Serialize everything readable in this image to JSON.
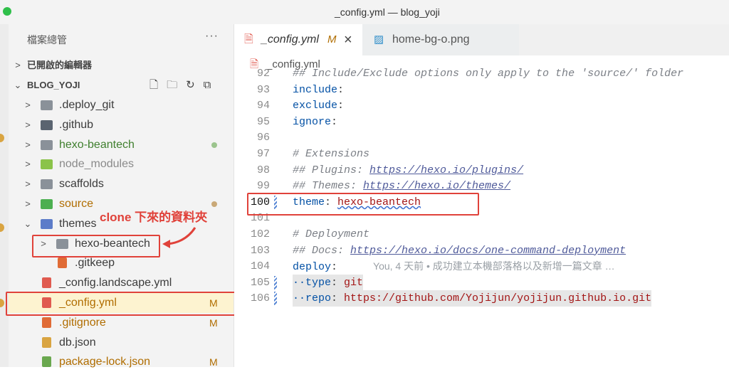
{
  "window": {
    "title": "_config.yml — blog_yoji"
  },
  "sidebar": {
    "header": "檔案總管",
    "more": "···",
    "open_editors": "已開啟的編輯器",
    "project": "BLOG_YOJI",
    "items": [
      {
        "label": ".deploy_git",
        "chevron": ">",
        "icon": "folder-icon",
        "color": "#8a9199"
      },
      {
        "label": ".github",
        "chevron": ">",
        "icon": "github-folder-icon",
        "color": "#5a6470"
      },
      {
        "label": "hexo-beantech",
        "chevron": ">",
        "icon": "folder-icon",
        "color": "#8a9199",
        "text_color": "#3f7f2e",
        "status_dot": "#9bc48d"
      },
      {
        "label": "node_modules",
        "chevron": ">",
        "icon": "node-folder-icon",
        "color": "#8bc34a",
        "text_color": "#8a8a8a"
      },
      {
        "label": "scaffolds",
        "chevron": ">",
        "icon": "folder-icon",
        "color": "#8a9199"
      },
      {
        "label": "source",
        "chevron": ">",
        "icon": "source-folder-icon",
        "color": "#4caf50",
        "text_color": "#b06d00",
        "status_dot": "#c9a877"
      },
      {
        "label": "themes",
        "chevron": "v",
        "icon": "theme-folder-icon",
        "color": "#5c7cc9"
      },
      {
        "label": "hexo-beantech",
        "chevron": ">",
        "icon": "folder-icon",
        "color": "#8a9199"
      },
      {
        "label": ".gitkeep",
        "icon": "git-icon",
        "color": "#e06b35"
      },
      {
        "label": "_config.landscape.yml",
        "icon": "yaml-icon",
        "color": "#e05a4f"
      },
      {
        "label": "_config.yml",
        "icon": "yaml-icon",
        "color": "#e05a4f",
        "text_color": "#b06d00",
        "badge": "M"
      },
      {
        "label": ".gitignore",
        "icon": "git-icon",
        "color": "#e06b35",
        "text_color": "#b06d00",
        "badge": "M"
      },
      {
        "label": "db.json",
        "icon": "json-icon",
        "color": "#d9a441"
      },
      {
        "label": "package-lock.json",
        "icon": "node-icon",
        "color": "#6aa84f",
        "text_color": "#b06d00",
        "badge": "M"
      }
    ]
  },
  "annotation": {
    "text": "clone 下來的資料夾"
  },
  "tabs": [
    {
      "label": "_config.yml",
      "modified": "M",
      "close": "×",
      "icon": "yaml-icon"
    },
    {
      "label": "home-bg-o.png",
      "icon": "image-icon"
    }
  ],
  "breadcrumb": {
    "file": "_config.yml"
  },
  "editor": {
    "lines": [
      {
        "n": "92",
        "parts": [
          {
            "t": "## Include/Exclude options only apply to the 'source/' folder",
            "c": "cmt"
          }
        ]
      },
      {
        "n": "93",
        "parts": [
          {
            "t": "include",
            "c": "key"
          },
          {
            "t": ":",
            "c": ""
          }
        ]
      },
      {
        "n": "94",
        "parts": [
          {
            "t": "exclude",
            "c": "key"
          },
          {
            "t": ":",
            "c": ""
          }
        ]
      },
      {
        "n": "95",
        "parts": [
          {
            "t": "ignore",
            "c": "key"
          },
          {
            "t": ":",
            "c": ""
          }
        ]
      },
      {
        "n": "96",
        "parts": []
      },
      {
        "n": "97",
        "parts": [
          {
            "t": "# Extensions",
            "c": "cmt"
          }
        ]
      },
      {
        "n": "98",
        "parts": [
          {
            "t": "## Plugins: ",
            "c": "cmt"
          },
          {
            "t": "https://hexo.io/plugins/",
            "c": "link"
          }
        ]
      },
      {
        "n": "99",
        "parts": [
          {
            "t": "## Themes: ",
            "c": "cmt"
          },
          {
            "t": "https://hexo.io/themes/",
            "c": "link"
          }
        ]
      },
      {
        "n": "100",
        "parts": [
          {
            "t": "theme",
            "c": "key"
          },
          {
            "t": ": ",
            "c": ""
          },
          {
            "t": "hexo-beantech",
            "c": "val"
          }
        ]
      },
      {
        "n": "101",
        "parts": []
      },
      {
        "n": "102",
        "parts": [
          {
            "t": "# Deployment",
            "c": "cmt"
          }
        ]
      },
      {
        "n": "103",
        "parts": [
          {
            "t": "## Docs: ",
            "c": "cmt"
          },
          {
            "t": "https://hexo.io/docs/one-command-deployment",
            "c": "link"
          }
        ]
      },
      {
        "n": "104",
        "parts": [
          {
            "t": "deploy",
            "c": "key"
          },
          {
            "t": ":",
            "c": ""
          }
        ]
      },
      {
        "n": "105",
        "parts": [
          {
            "t": "··type",
            "c": "key"
          },
          {
            "t": ": ",
            "c": ""
          },
          {
            "t": "git",
            "c": "val"
          }
        ]
      },
      {
        "n": "106",
        "parts": [
          {
            "t": "··repo",
            "c": "key"
          },
          {
            "t": ": ",
            "c": ""
          },
          {
            "t": "https://github.com/Yojijun/yojijun.github.io.git",
            "c": "val"
          }
        ]
      }
    ],
    "blame": "You, 4 天前 • 成功建立本機部落格以及新增一篇文章 …"
  }
}
